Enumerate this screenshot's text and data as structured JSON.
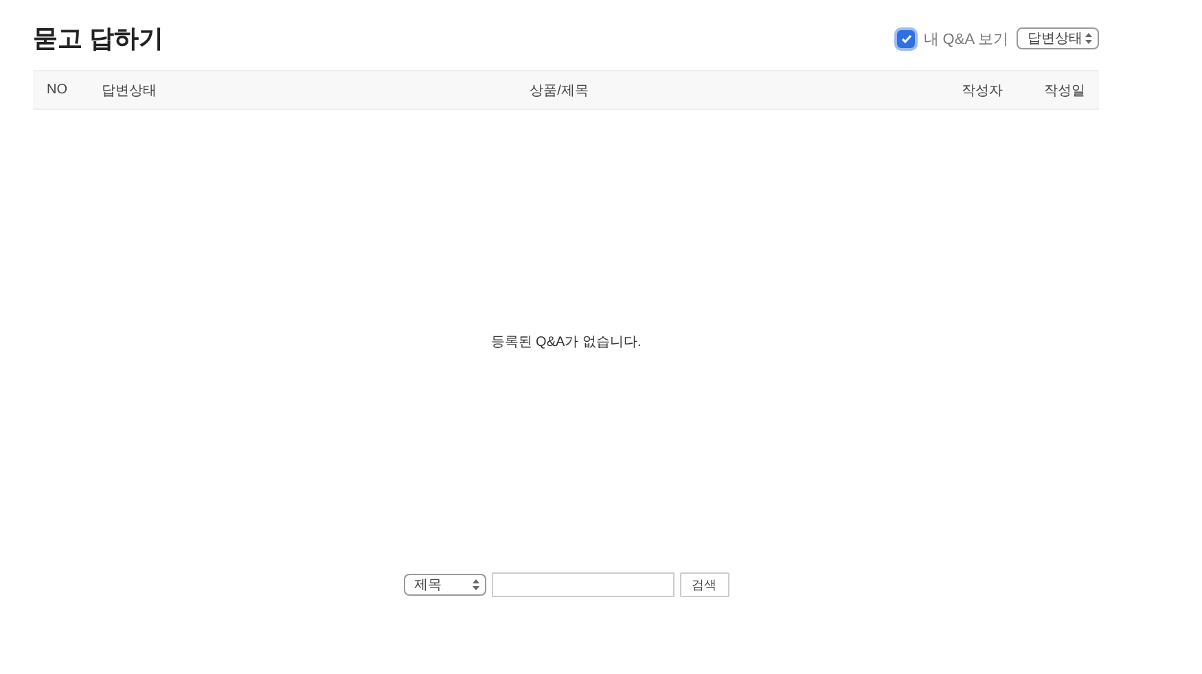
{
  "title": "묻고 답하기",
  "my_qa": {
    "label": "내 Q&A 보기",
    "checked": true
  },
  "status_filter": {
    "value": "답변상태"
  },
  "table": {
    "columns": [
      "NO",
      "답변상태",
      "상품/제목",
      "작성자",
      "작성일"
    ],
    "empty_message": "등록된 Q&A가 없습니다."
  },
  "search": {
    "field_select": "제목",
    "button": "검색"
  }
}
